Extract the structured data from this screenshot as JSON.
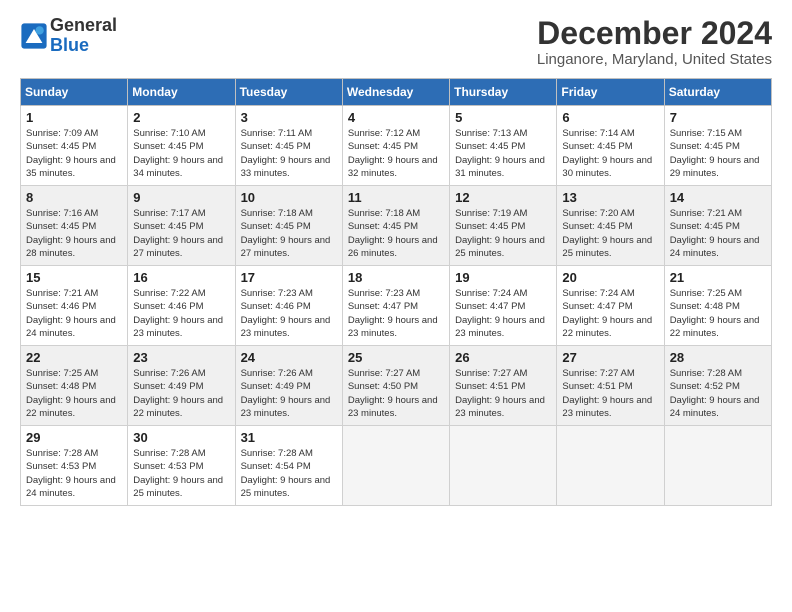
{
  "header": {
    "logo": {
      "line1": "General",
      "line2": "Blue"
    },
    "title": "December 2024",
    "subtitle": "Linganore, Maryland, United States"
  },
  "calendar": {
    "days_of_week": [
      "Sunday",
      "Monday",
      "Tuesday",
      "Wednesday",
      "Thursday",
      "Friday",
      "Saturday"
    ],
    "weeks": [
      [
        {
          "day": "1",
          "sunrise": "7:09 AM",
          "sunset": "4:45 PM",
          "daylight": "9 hours and 35 minutes."
        },
        {
          "day": "2",
          "sunrise": "7:10 AM",
          "sunset": "4:45 PM",
          "daylight": "9 hours and 34 minutes."
        },
        {
          "day": "3",
          "sunrise": "7:11 AM",
          "sunset": "4:45 PM",
          "daylight": "9 hours and 33 minutes."
        },
        {
          "day": "4",
          "sunrise": "7:12 AM",
          "sunset": "4:45 PM",
          "daylight": "9 hours and 32 minutes."
        },
        {
          "day": "5",
          "sunrise": "7:13 AM",
          "sunset": "4:45 PM",
          "daylight": "9 hours and 31 minutes."
        },
        {
          "day": "6",
          "sunrise": "7:14 AM",
          "sunset": "4:45 PM",
          "daylight": "9 hours and 30 minutes."
        },
        {
          "day": "7",
          "sunrise": "7:15 AM",
          "sunset": "4:45 PM",
          "daylight": "9 hours and 29 minutes."
        }
      ],
      [
        {
          "day": "8",
          "sunrise": "7:16 AM",
          "sunset": "4:45 PM",
          "daylight": "9 hours and 28 minutes."
        },
        {
          "day": "9",
          "sunrise": "7:17 AM",
          "sunset": "4:45 PM",
          "daylight": "9 hours and 27 minutes."
        },
        {
          "day": "10",
          "sunrise": "7:18 AM",
          "sunset": "4:45 PM",
          "daylight": "9 hours and 27 minutes."
        },
        {
          "day": "11",
          "sunrise": "7:18 AM",
          "sunset": "4:45 PM",
          "daylight": "9 hours and 26 minutes."
        },
        {
          "day": "12",
          "sunrise": "7:19 AM",
          "sunset": "4:45 PM",
          "daylight": "9 hours and 25 minutes."
        },
        {
          "day": "13",
          "sunrise": "7:20 AM",
          "sunset": "4:45 PM",
          "daylight": "9 hours and 25 minutes."
        },
        {
          "day": "14",
          "sunrise": "7:21 AM",
          "sunset": "4:45 PM",
          "daylight": "9 hours and 24 minutes."
        }
      ],
      [
        {
          "day": "15",
          "sunrise": "7:21 AM",
          "sunset": "4:46 PM",
          "daylight": "9 hours and 24 minutes."
        },
        {
          "day": "16",
          "sunrise": "7:22 AM",
          "sunset": "4:46 PM",
          "daylight": "9 hours and 23 minutes."
        },
        {
          "day": "17",
          "sunrise": "7:23 AM",
          "sunset": "4:46 PM",
          "daylight": "9 hours and 23 minutes."
        },
        {
          "day": "18",
          "sunrise": "7:23 AM",
          "sunset": "4:47 PM",
          "daylight": "9 hours and 23 minutes."
        },
        {
          "day": "19",
          "sunrise": "7:24 AM",
          "sunset": "4:47 PM",
          "daylight": "9 hours and 23 minutes."
        },
        {
          "day": "20",
          "sunrise": "7:24 AM",
          "sunset": "4:47 PM",
          "daylight": "9 hours and 22 minutes."
        },
        {
          "day": "21",
          "sunrise": "7:25 AM",
          "sunset": "4:48 PM",
          "daylight": "9 hours and 22 minutes."
        }
      ],
      [
        {
          "day": "22",
          "sunrise": "7:25 AM",
          "sunset": "4:48 PM",
          "daylight": "9 hours and 22 minutes."
        },
        {
          "day": "23",
          "sunrise": "7:26 AM",
          "sunset": "4:49 PM",
          "daylight": "9 hours and 22 minutes."
        },
        {
          "day": "24",
          "sunrise": "7:26 AM",
          "sunset": "4:49 PM",
          "daylight": "9 hours and 23 minutes."
        },
        {
          "day": "25",
          "sunrise": "7:27 AM",
          "sunset": "4:50 PM",
          "daylight": "9 hours and 23 minutes."
        },
        {
          "day": "26",
          "sunrise": "7:27 AM",
          "sunset": "4:51 PM",
          "daylight": "9 hours and 23 minutes."
        },
        {
          "day": "27",
          "sunrise": "7:27 AM",
          "sunset": "4:51 PM",
          "daylight": "9 hours and 23 minutes."
        },
        {
          "day": "28",
          "sunrise": "7:28 AM",
          "sunset": "4:52 PM",
          "daylight": "9 hours and 24 minutes."
        }
      ],
      [
        {
          "day": "29",
          "sunrise": "7:28 AM",
          "sunset": "4:53 PM",
          "daylight": "9 hours and 24 minutes."
        },
        {
          "day": "30",
          "sunrise": "7:28 AM",
          "sunset": "4:53 PM",
          "daylight": "9 hours and 25 minutes."
        },
        {
          "day": "31",
          "sunrise": "7:28 AM",
          "sunset": "4:54 PM",
          "daylight": "9 hours and 25 minutes."
        },
        null,
        null,
        null,
        null
      ]
    ]
  }
}
